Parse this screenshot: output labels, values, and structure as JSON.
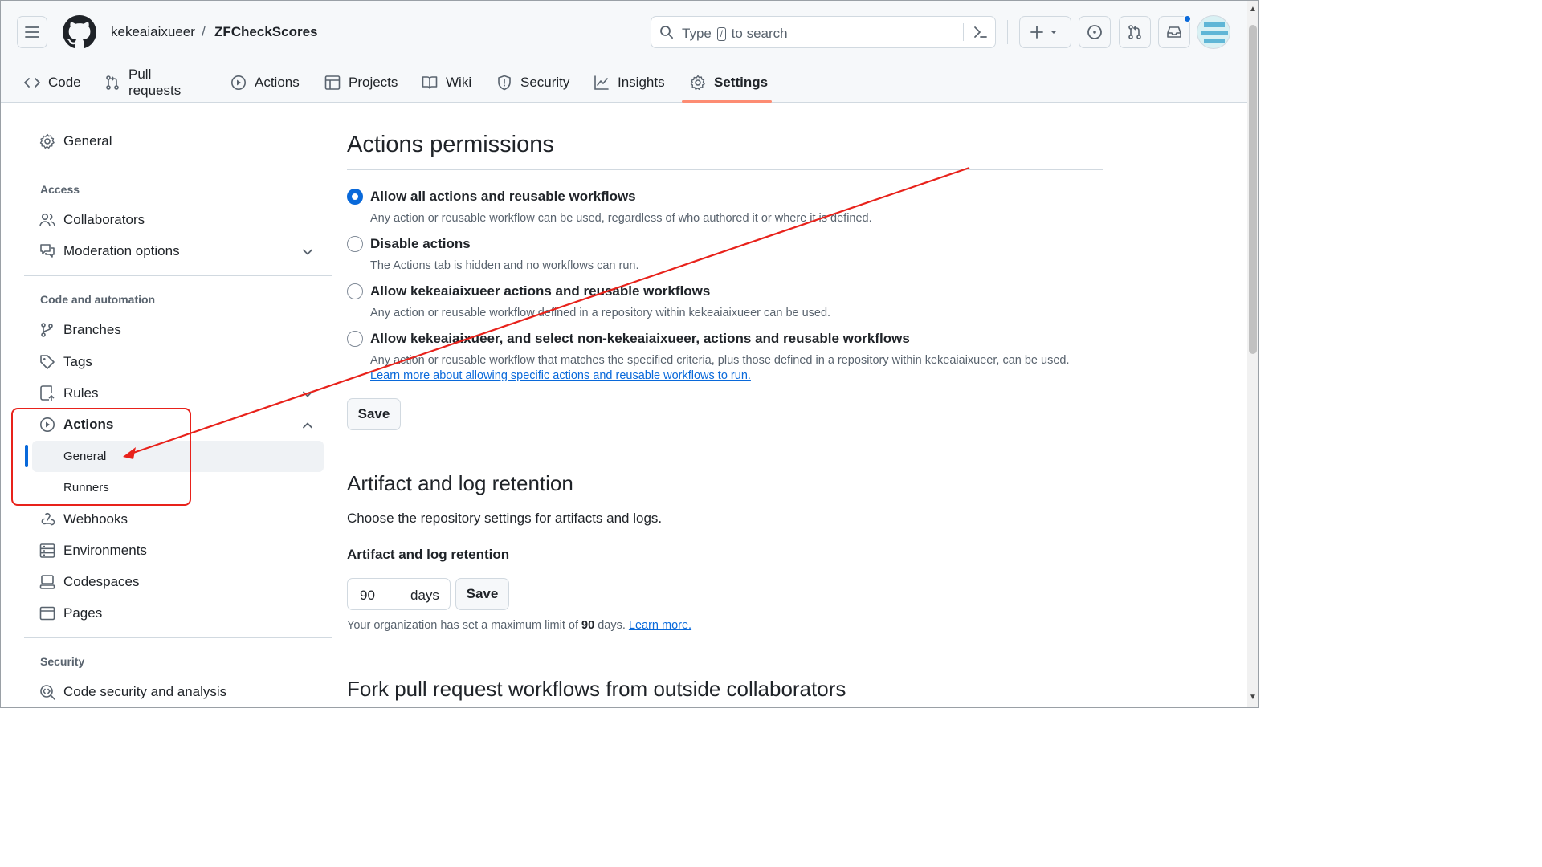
{
  "header": {
    "owner": "kekeaiaixueer",
    "separator": "/",
    "repo": "ZFCheckScores",
    "search_prefix": "Type",
    "search_key": "/",
    "search_suffix": "to search"
  },
  "tabs": [
    {
      "label": "Code",
      "icon": "code-icon"
    },
    {
      "label": "Pull requests",
      "icon": "git-pull-request-icon"
    },
    {
      "label": "Actions",
      "icon": "play-icon"
    },
    {
      "label": "Projects",
      "icon": "table-icon"
    },
    {
      "label": "Wiki",
      "icon": "book-icon"
    },
    {
      "label": "Security",
      "icon": "shield-icon"
    },
    {
      "label": "Insights",
      "icon": "graph-icon"
    },
    {
      "label": "Settings",
      "icon": "gear-icon",
      "selected": true
    }
  ],
  "sidebar": {
    "general": "General",
    "access_heading": "Access",
    "collaborators": "Collaborators",
    "moderation": "Moderation options",
    "code_heading": "Code and automation",
    "branches": "Branches",
    "tags": "Tags",
    "rules": "Rules",
    "actions": "Actions",
    "actions_general": "General",
    "actions_runners": "Runners",
    "webhooks": "Webhooks",
    "environments": "Environments",
    "codespaces": "Codespaces",
    "pages": "Pages",
    "security_heading": "Security",
    "code_security": "Code security and analysis"
  },
  "main": {
    "permissions_title": "Actions permissions",
    "options": [
      {
        "label": "Allow all actions and reusable workflows",
        "desc": "Any action or reusable workflow can be used, regardless of who authored it or where it is defined.",
        "checked": true
      },
      {
        "label": "Disable actions",
        "desc": "The Actions tab is hidden and no workflows can run.",
        "checked": false
      },
      {
        "label": "Allow kekeaiaixueer actions and reusable workflows",
        "desc": "Any action or reusable workflow defined in a repository within kekeaiaixueer can be used.",
        "checked": false
      },
      {
        "label": "Allow kekeaiaixueer, and select non-kekeaiaixueer, actions and reusable workflows",
        "desc": "Any action or reusable workflow that matches the specified criteria, plus those defined in a repository within kekeaiaixueer, can be used.",
        "link": "Learn more about allowing specific actions and reusable workflows to run.",
        "checked": false
      }
    ],
    "save_label": "Save",
    "retention_title": "Artifact and log retention",
    "retention_desc": "Choose the repository settings for artifacts and logs.",
    "retention_label": "Artifact and log retention",
    "retention_value": "90",
    "retention_unit": "days",
    "retention_save": "Save",
    "note_prefix": "Your organization has set a maximum limit of",
    "note_value": "90",
    "note_suffix": "days.",
    "note_link": "Learn more.",
    "fork_title": "Fork pull request workflows from outside collaborators"
  },
  "colors": {
    "accent": "#0969da",
    "tab_underline": "#fd8c73",
    "annotation": "#e8221b"
  }
}
